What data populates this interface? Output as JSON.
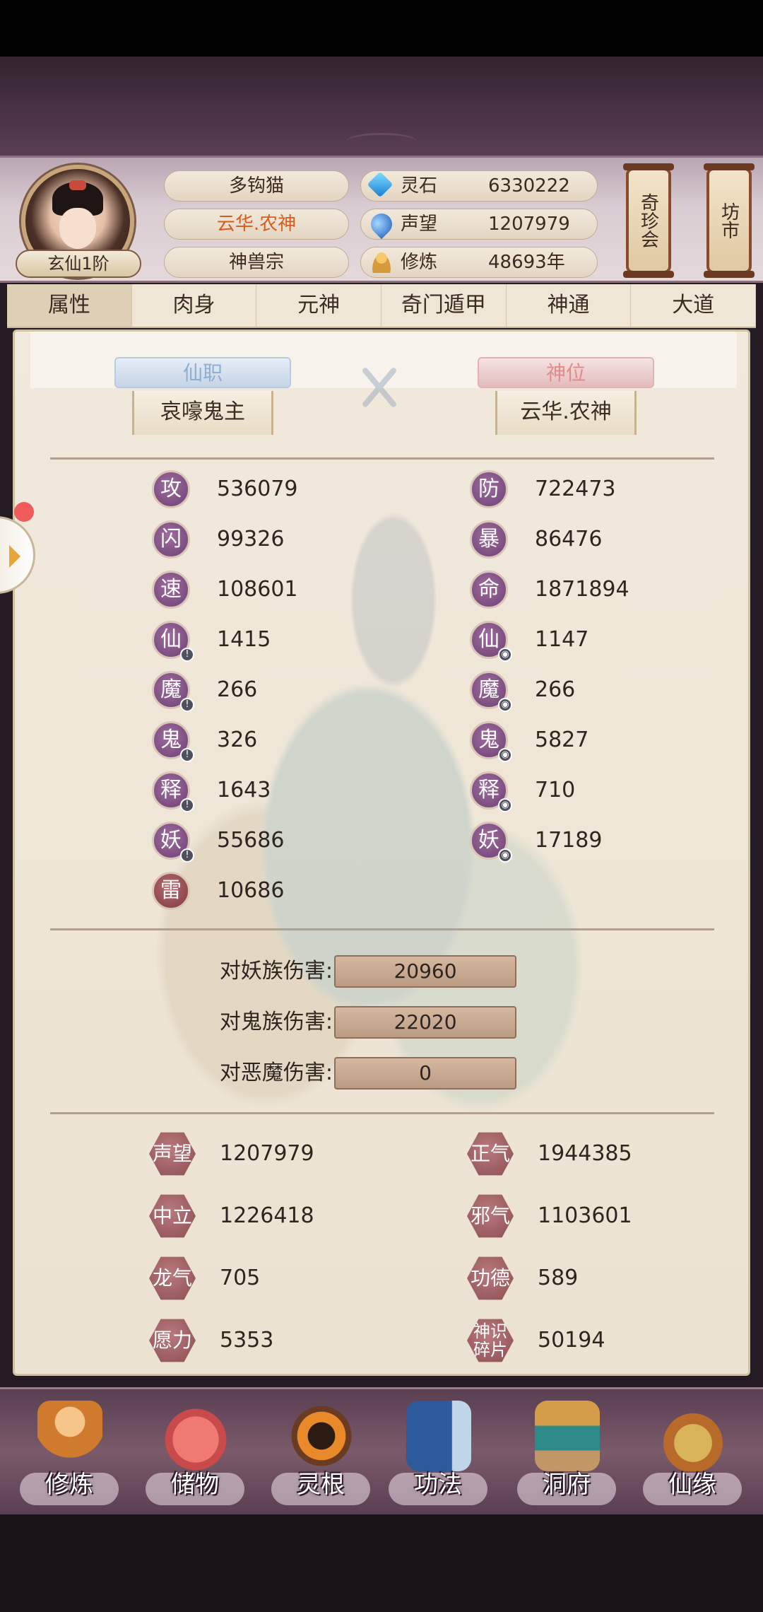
{
  "header": {
    "rank": "玄仙1阶",
    "player_name": "多钩猫",
    "title": "云华.农神",
    "sect": "神兽宗",
    "resources": [
      {
        "icon": "spirit-stone-icon",
        "label": "灵石",
        "value": "6330222"
      },
      {
        "icon": "prestige-icon",
        "label": "声望",
        "value": "1207979"
      },
      {
        "icon": "cultivation-icon",
        "label": "修炼",
        "value": "48693年"
      }
    ],
    "side_buttons": [
      "奇珍会",
      "坊市"
    ]
  },
  "tabs": [
    "属性",
    "肉身",
    "元神",
    "奇门遁甲",
    "神通",
    "大道"
  ],
  "active_tab": "属性",
  "titles": {
    "left": {
      "tag": "仙职",
      "name": "哀嚎鬼主"
    },
    "right": {
      "tag": "神位",
      "name": "云华.农神"
    }
  },
  "stats_left": [
    {
      "label": "攻",
      "value": "536079"
    },
    {
      "label": "闪",
      "value": "99326"
    },
    {
      "label": "速",
      "value": "108601"
    },
    {
      "label": "仙",
      "value": "1415"
    },
    {
      "label": "魔",
      "value": "266"
    },
    {
      "label": "鬼",
      "value": "326"
    },
    {
      "label": "释",
      "value": "1643"
    },
    {
      "label": "妖",
      "value": "55686"
    },
    {
      "label": "雷",
      "value": "10686"
    }
  ],
  "stats_right": [
    {
      "label": "防",
      "value": "722473"
    },
    {
      "label": "暴",
      "value": "86476"
    },
    {
      "label": "命",
      "value": "1871894"
    },
    {
      "label": "仙",
      "value": "1147"
    },
    {
      "label": "魔",
      "value": "266"
    },
    {
      "label": "鬼",
      "value": "5827"
    },
    {
      "label": "释",
      "value": "710"
    },
    {
      "label": "妖",
      "value": "17189"
    }
  ],
  "damage": [
    {
      "label": "对妖族伤害:",
      "value": "20960"
    },
    {
      "label": "对鬼族伤害:",
      "value": "22020"
    },
    {
      "label": "对恶魔伤害:",
      "value": "0"
    }
  ],
  "reputation_left": [
    {
      "label": "声望",
      "value": "1207979"
    },
    {
      "label": "中立",
      "value": "1226418"
    },
    {
      "label": "龙气",
      "value": "705"
    },
    {
      "label": "愿力",
      "value": "5353"
    }
  ],
  "reputation_right": [
    {
      "label": "正气",
      "value": "1944385"
    },
    {
      "label": "邪气",
      "value": "1103601"
    },
    {
      "label": "功德",
      "value": "589"
    },
    {
      "label": "神识碎片",
      "value": "50194"
    }
  ],
  "bottom_nav": [
    {
      "label": "修炼",
      "icon": "cultivate-icon"
    },
    {
      "label": "储物",
      "icon": "storage-bag-icon"
    },
    {
      "label": "灵根",
      "icon": "spirit-root-icon"
    },
    {
      "label": "功法",
      "icon": "technique-book-icon"
    },
    {
      "label": "洞府",
      "icon": "cave-house-icon"
    },
    {
      "label": "仙缘",
      "icon": "fortune-gourd-icon"
    }
  ]
}
